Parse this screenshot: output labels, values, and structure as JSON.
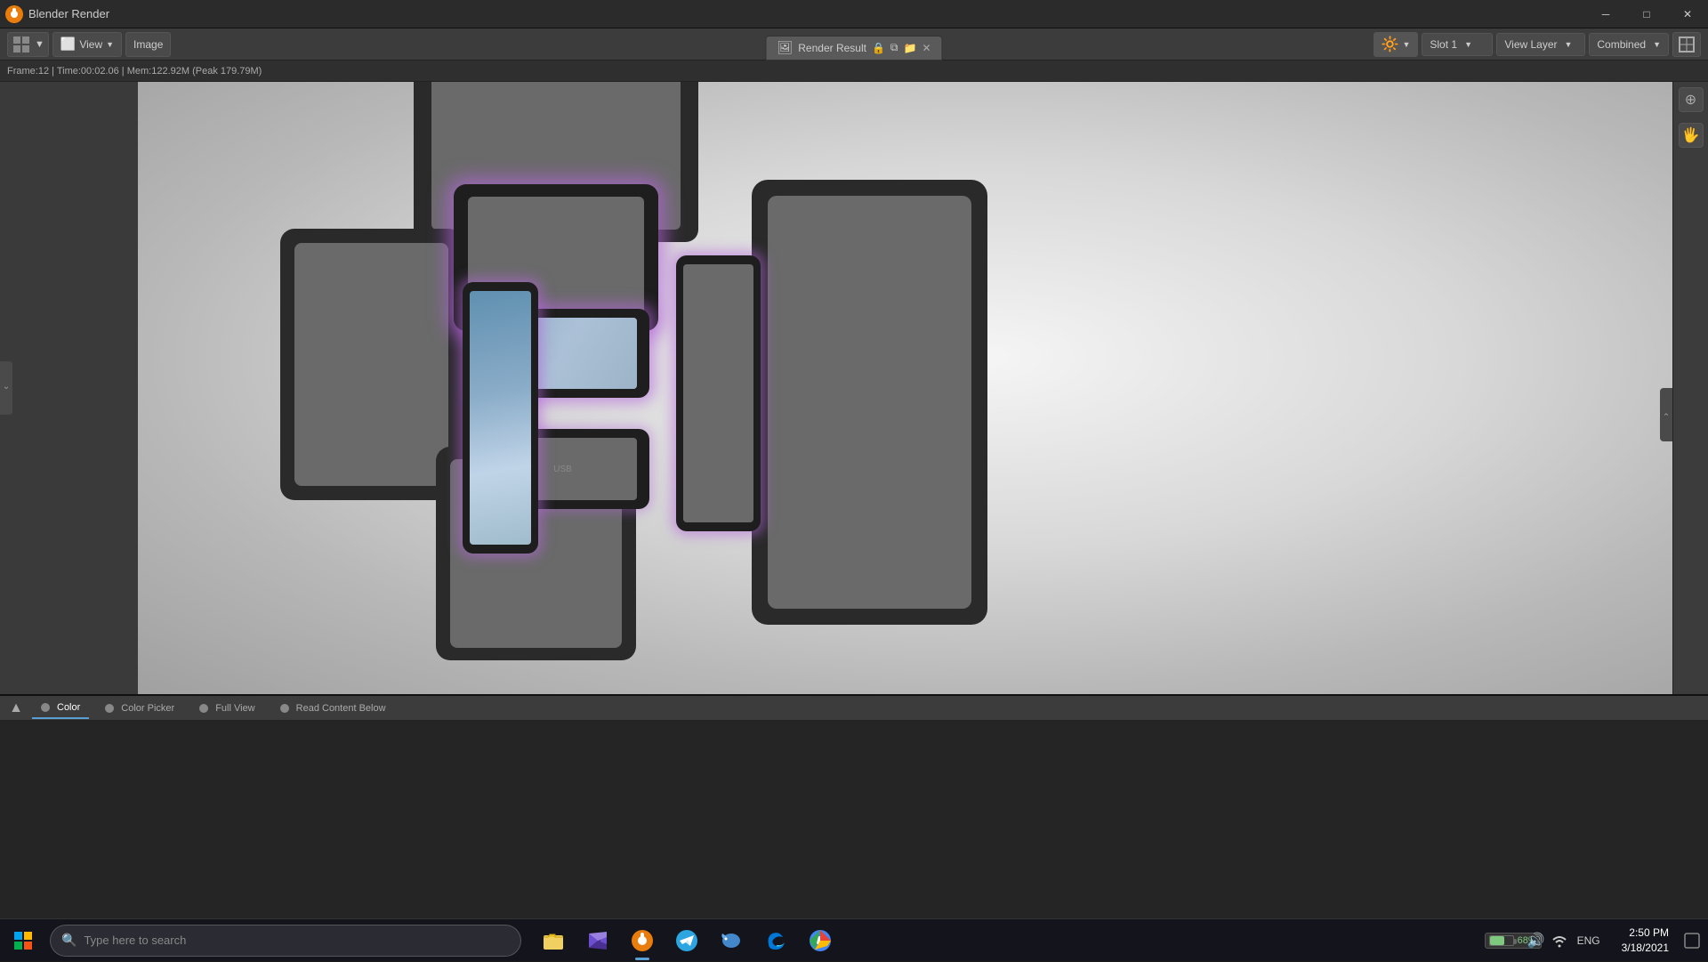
{
  "titlebar": {
    "logo_alt": "Blender",
    "title": "Blender Render",
    "minimize": "─",
    "maximize": "□",
    "close": "✕"
  },
  "header": {
    "view_icon": "≡",
    "view_label": "View",
    "image_label": "Image",
    "render_icon": "⬛",
    "render_tab_label": "Render Result",
    "close_tab": "✕",
    "slot_label": "Slot 1",
    "view_layer_label": "View Layer",
    "combined_label": "Combined",
    "expand_icon": "▼"
  },
  "status": {
    "text": "Frame:12 | Time:00:02.06 | Mem:122.92M (Peak 179.79M)"
  },
  "right_tools": {
    "zoom_in": "+",
    "hand": "✋"
  },
  "bottom_tabs": {
    "color": "Color",
    "color_picker": "Color Picker",
    "full_view": "Full View",
    "read_content": "Read Content Below"
  },
  "taskbar": {
    "search_placeholder": "Type here to search",
    "search_icon": "🔍",
    "start_icon": "⊞",
    "apps": [
      {
        "name": "file-explorer",
        "label": "📁"
      },
      {
        "name": "visual-studio",
        "label": "VS"
      },
      {
        "name": "blender",
        "label": "B"
      },
      {
        "name": "telegram",
        "label": "✈"
      },
      {
        "name": "dolphin",
        "label": "🐬"
      },
      {
        "name": "edge",
        "label": "⊕"
      },
      {
        "name": "chrome",
        "label": "⊙"
      }
    ],
    "battery": "68%",
    "time": "2:50 PM",
    "date": "3/18/2021",
    "lang": "ENG"
  },
  "colors": {
    "bg_dark": "#1a1a1a",
    "toolbar": "#3c3c3c",
    "panel": "#2f2f2f",
    "accent_blue": "#5a9fd4",
    "purple_glow": "rgba(180,100,220,0.6)",
    "device_dark": "#2a2a2a",
    "scene_bg": "#d0d0d0"
  }
}
